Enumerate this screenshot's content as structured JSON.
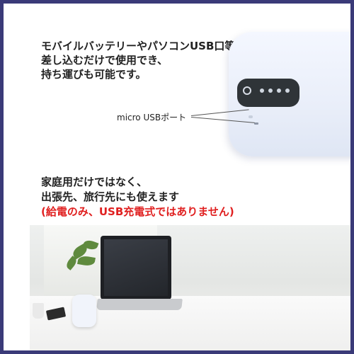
{
  "headline": {
    "line1": "モバイルバッテリーやパソコンUSB口等に",
    "line2": "差し込むだけで使用でき、",
    "line3": "持ち運びも可能です。"
  },
  "port_label": "micro USBポート",
  "subhead": {
    "line1": "家庭用だけではなく、",
    "line2": "出張先、旅行先にも使えます",
    "note": "(給電のみ、USB充電式ではありません)"
  },
  "colors": {
    "frame": "#3a3a78",
    "text": "#222222",
    "note": "#e02020",
    "device_panel": "#2f3438"
  }
}
